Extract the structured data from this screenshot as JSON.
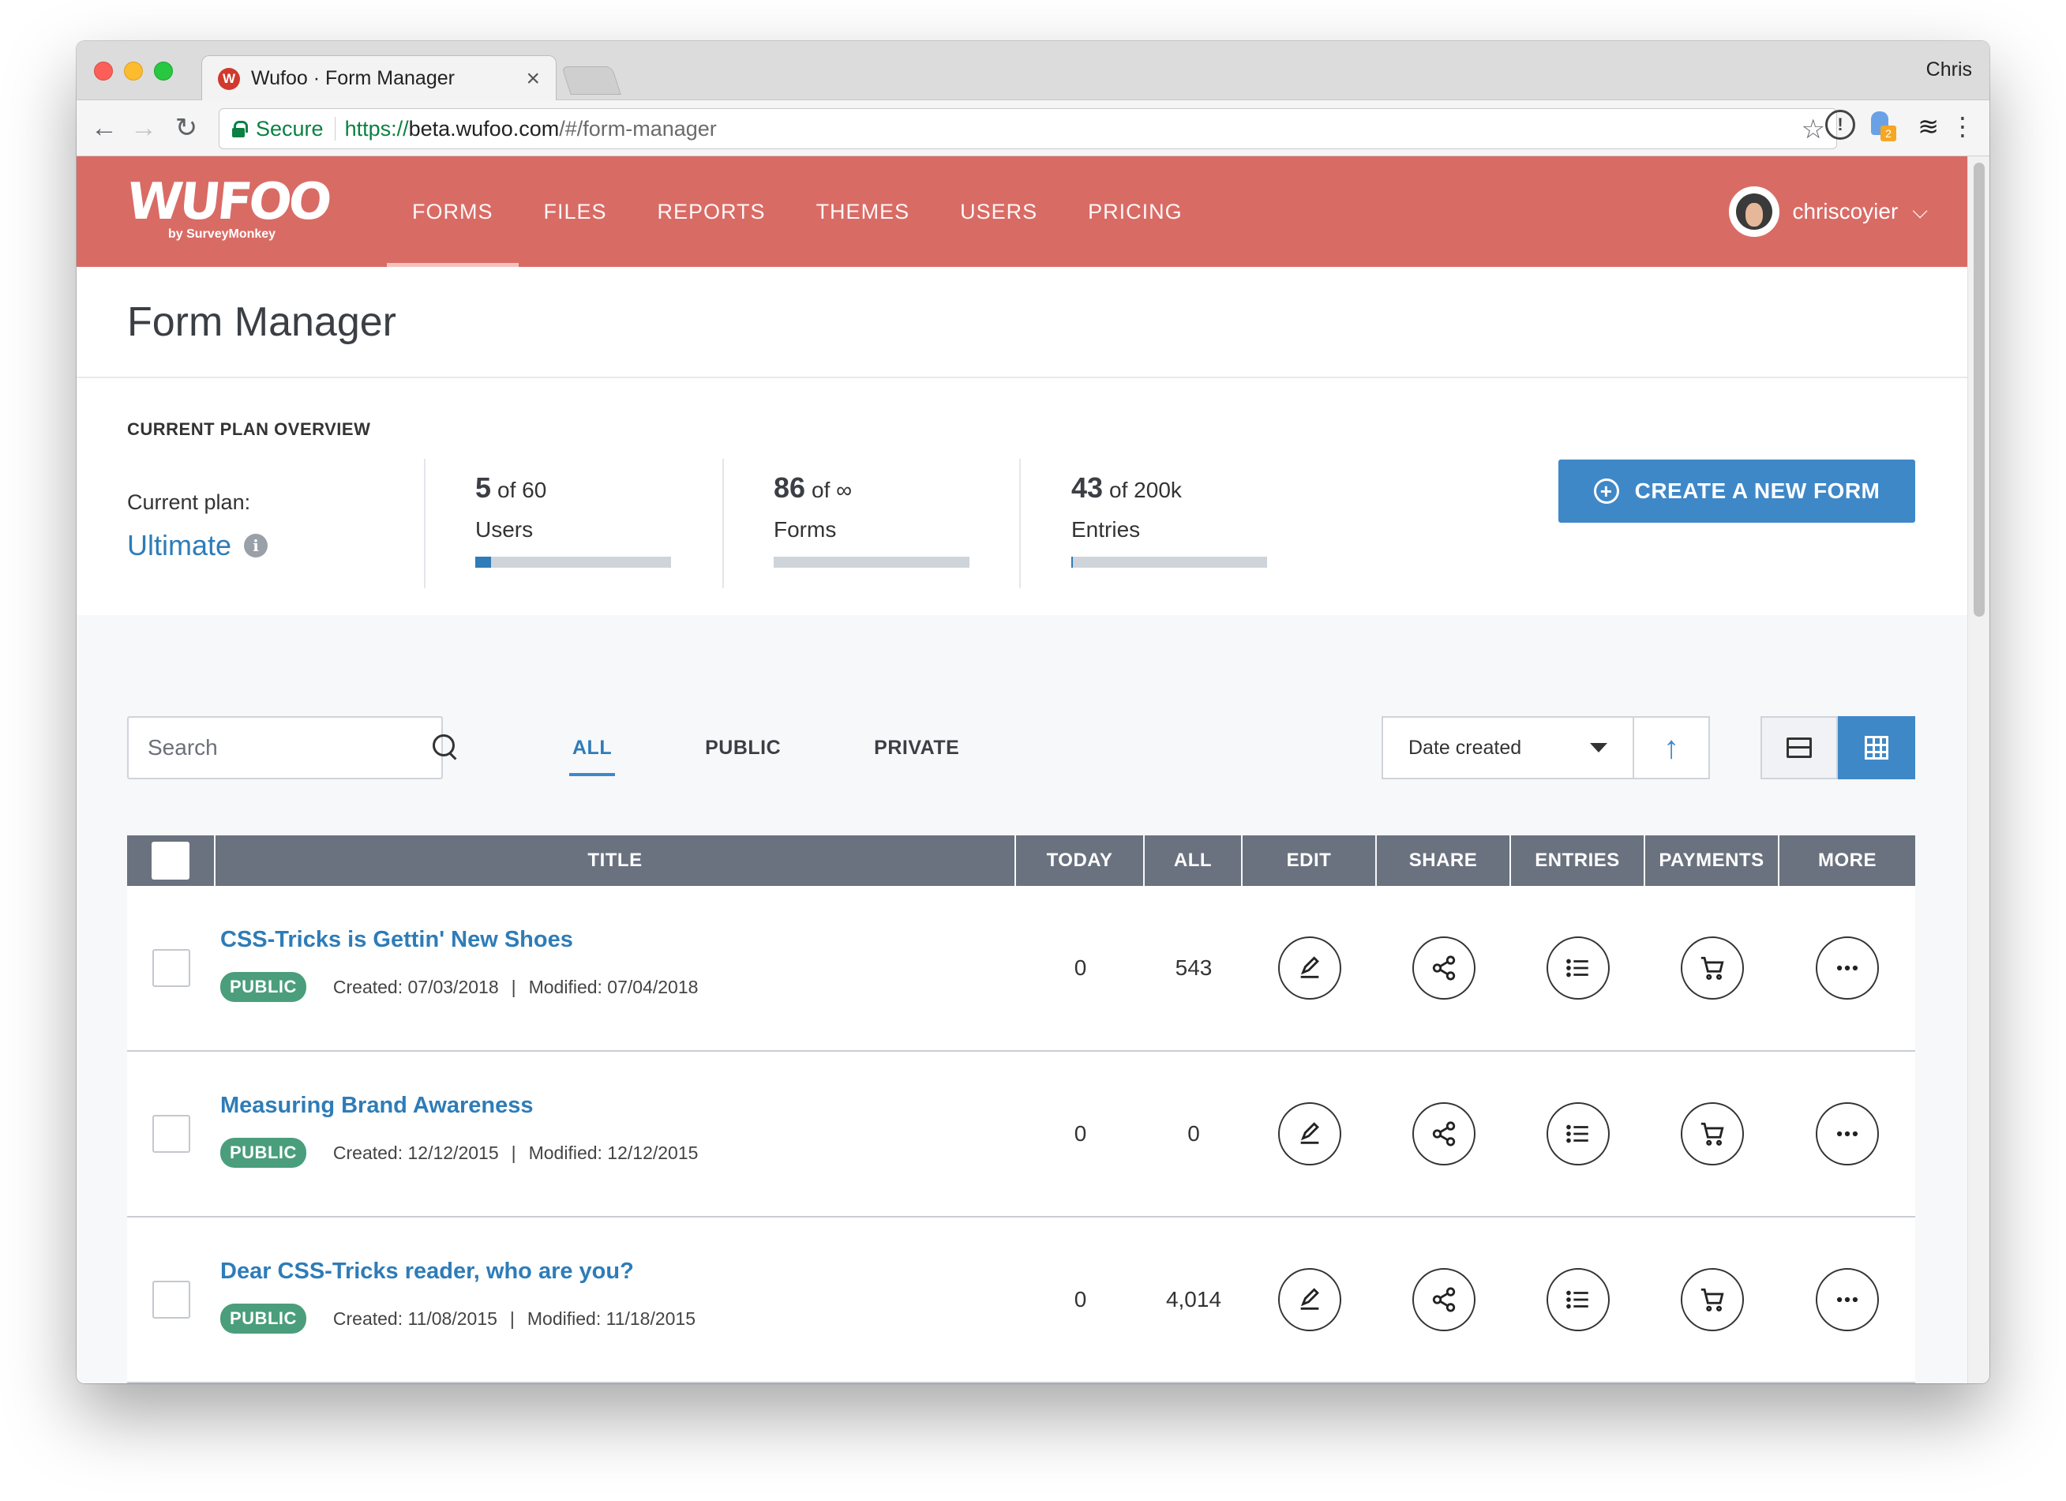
{
  "browser": {
    "tab_title": "Wufoo · Form Manager",
    "tab_favicon_letter": "W",
    "tab_close": "×",
    "profile_name": "Chris",
    "secure_label": "Secure",
    "url_scheme": "https://",
    "url_host": "beta.wufoo.com",
    "url_path": "/#/form-manager",
    "ext_badge": "2"
  },
  "header": {
    "logo_text": "WUFOO",
    "logo_sub": "by SurveyMonkey",
    "nav": [
      "FORMS",
      "FILES",
      "REPORTS",
      "THEMES",
      "USERS",
      "PRICING"
    ],
    "active_nav": "FORMS",
    "username": "chriscoyier",
    "brand_color": "#d96b65"
  },
  "page": {
    "title": "Form Manager"
  },
  "plan": {
    "heading": "CURRENT PLAN OVERVIEW",
    "current_label": "Current plan:",
    "plan_name": "Ultimate",
    "info_icon": "i",
    "stats": [
      {
        "value": "5",
        "of": "of 60",
        "label": "Users",
        "fill_fraction": 0.08
      },
      {
        "value": "86",
        "of": "of ∞",
        "label": "Forms",
        "fill_fraction": 0.0
      },
      {
        "value": "43",
        "of": "of 200k",
        "label": "Entries",
        "fill_fraction": 0.01
      }
    ],
    "create_button": "CREATE A NEW FORM",
    "accent_color": "#3f88c8"
  },
  "filters": {
    "search_placeholder": "Search",
    "tabs": [
      "ALL",
      "PUBLIC",
      "PRIVATE"
    ],
    "active_tab": "ALL",
    "sort_value": "Date created",
    "sort_direction_icon": "↑"
  },
  "table": {
    "columns": [
      "TITLE",
      "TODAY",
      "ALL",
      "EDIT",
      "SHARE",
      "ENTRIES",
      "PAYMENTS",
      "MORE"
    ],
    "rows": [
      {
        "title": "CSS-Tricks is Gettin' New Shoes",
        "status": "PUBLIC",
        "created": "Created: 07/03/2018",
        "modified": "Modified: 07/04/2018",
        "today": "0",
        "all": "543"
      },
      {
        "title": "Measuring Brand Awareness",
        "status": "PUBLIC",
        "created": "Created: 12/12/2015",
        "modified": "Modified: 12/12/2015",
        "today": "0",
        "all": "0"
      },
      {
        "title": "Dear CSS-Tricks reader, who are you?",
        "status": "PUBLIC",
        "created": "Created: 11/08/2015",
        "modified": "Modified: 11/18/2015",
        "today": "0",
        "all": "4,014"
      }
    ],
    "meta_separator": "|",
    "badge_color": "#4a9e7c"
  }
}
